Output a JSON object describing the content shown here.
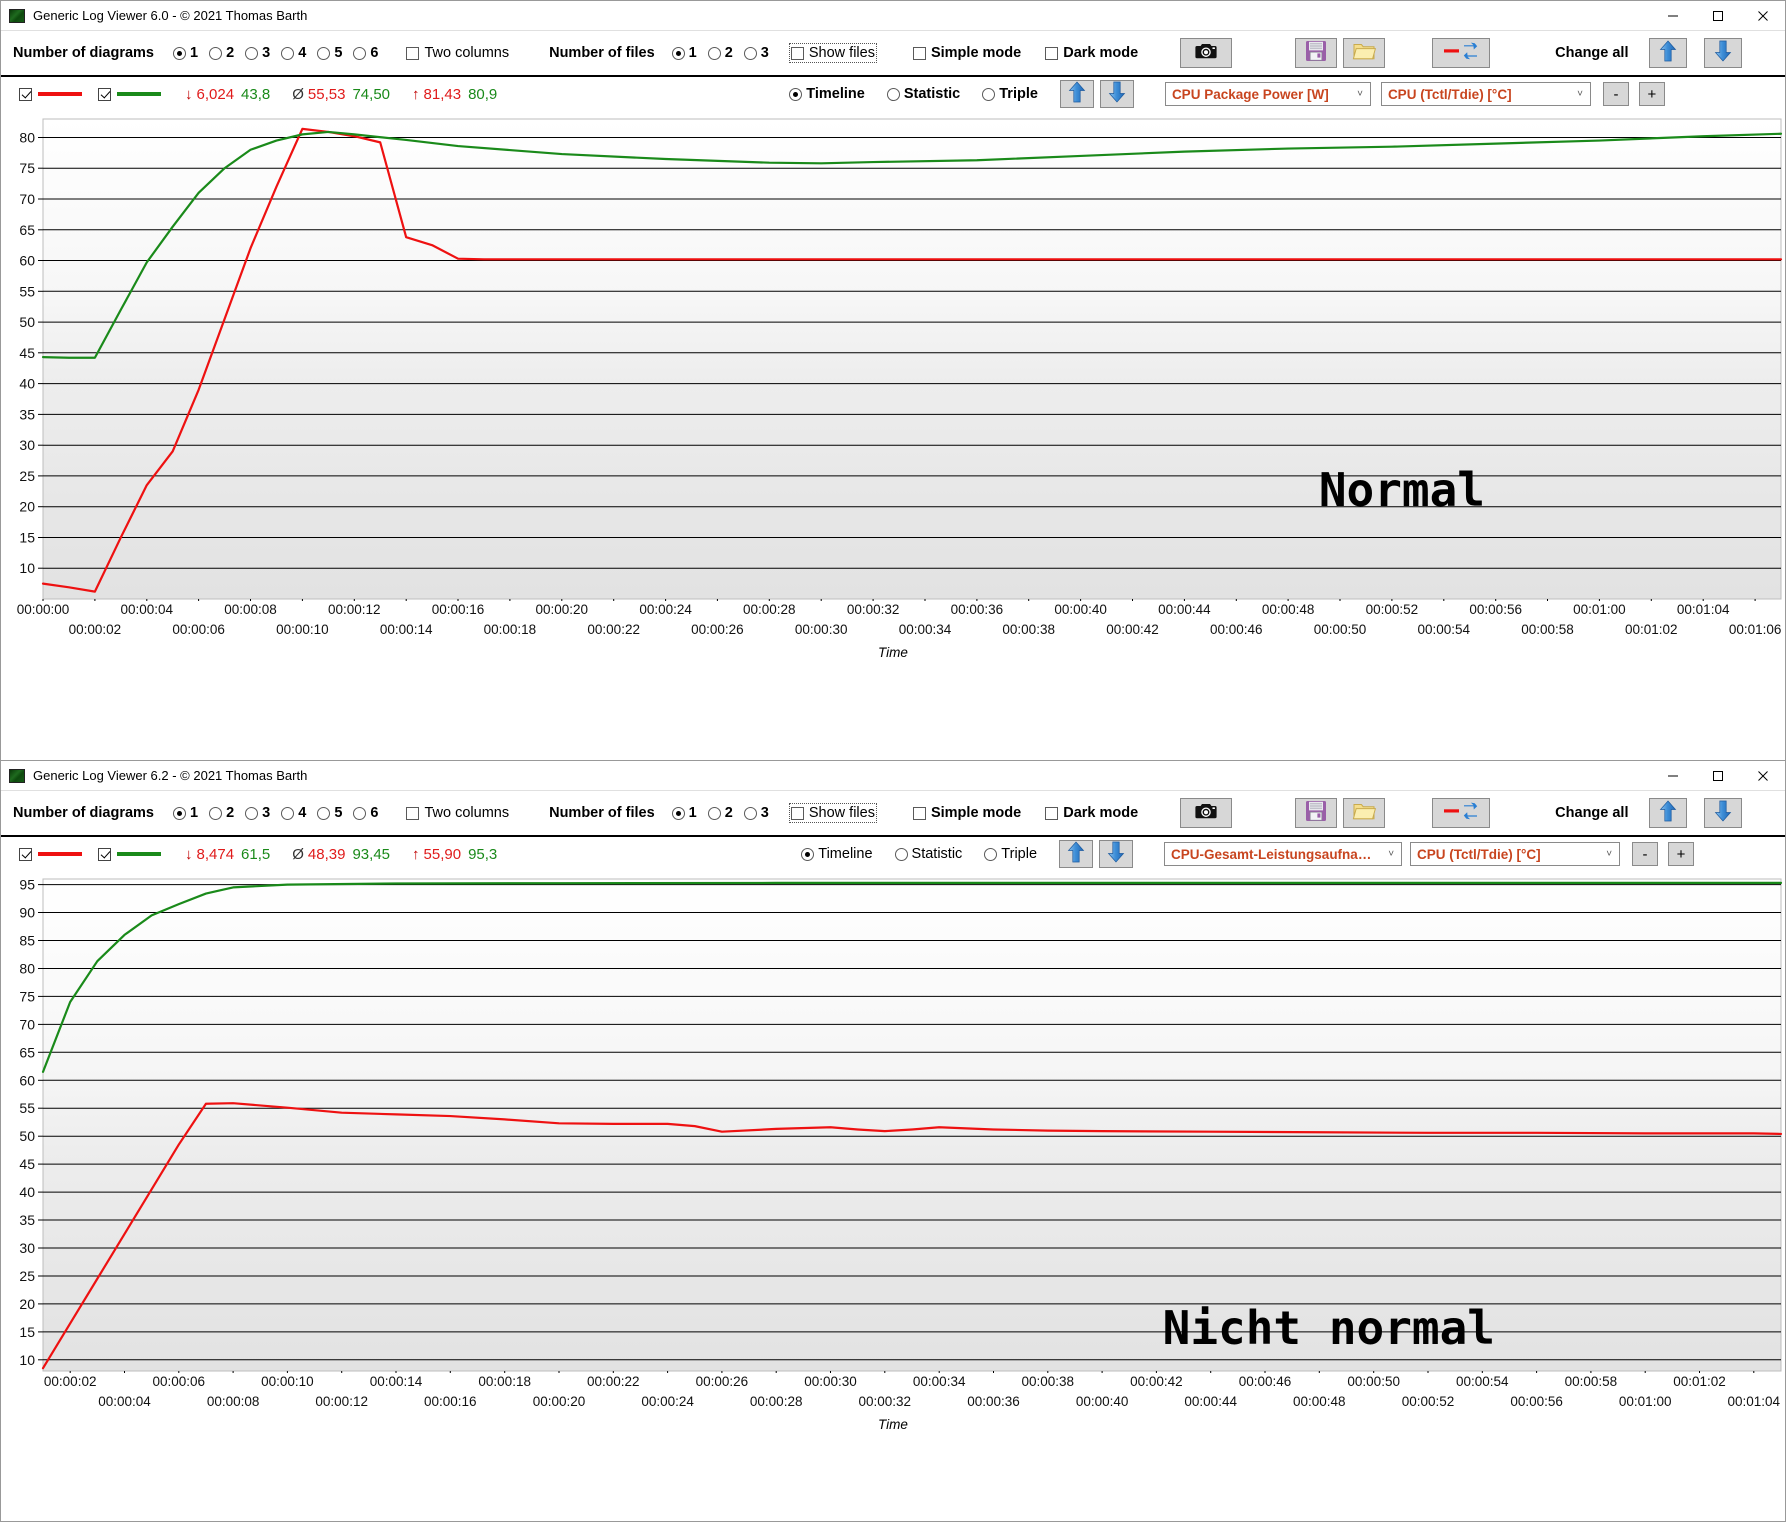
{
  "windows": [
    {
      "title": "Generic Log Viewer 6.0 - © 2021 Thomas Barth",
      "window_buttons": {
        "minimize": "minimize-icon",
        "maximize": "maximize-icon",
        "close": "close-icon"
      },
      "toolbar": {
        "diagrams_label": "Number of diagrams",
        "diagram_options": [
          "1",
          "2",
          "3",
          "4",
          "5",
          "6"
        ],
        "diagram_selected": "1",
        "two_columns_label": "Two columns",
        "two_columns_checked": false,
        "files_label": "Number of files",
        "file_options": [
          "1",
          "2",
          "3"
        ],
        "file_selected": "1",
        "show_files_label": "Show files",
        "show_files_checked": false,
        "simple_mode_label": "Simple mode",
        "simple_mode_checked": false,
        "dark_mode_label": "Dark mode",
        "dark_mode_checked": false,
        "screenshot_icon": "camera-icon",
        "save_icon": "floppy-disk-icon",
        "open_icon": "folder-icon",
        "reload_icon": "refresh-icon",
        "change_all_label": "Change all",
        "change_all_up_icon": "arrow-up-icon",
        "change_all_down_icon": "arrow-down-icon"
      },
      "chartbar": {
        "series1_checked": true,
        "series2_checked": true,
        "series1_color": "#ee1111",
        "series2_color": "#1a8a1a",
        "min_symbol": "↓",
        "min_red": "6,024",
        "min_green": "43,8",
        "avg_symbol": "Ø",
        "avg_red": "55,53",
        "avg_green": "74,50",
        "max_symbol": "↑",
        "max_red": "81,43",
        "max_green": "80,9",
        "view_modes": [
          "Timeline",
          "Statistic",
          "Triple"
        ],
        "view_mode_selected": "Timeline",
        "up_icon": "arrow-up-icon",
        "down_icon": "arrow-down-icon",
        "left_series_select": "CPU Package Power [W]",
        "right_series_select": "CPU (Tctl/Tdie) [°C]",
        "minus_label": "-",
        "plus_label": "+"
      },
      "annotation": "Normal",
      "xaxis_title": "Time",
      "chart_data": {
        "type": "line",
        "title": "",
        "xlabel": "Time",
        "ylabel": "",
        "ylim": [
          5,
          83
        ],
        "yticks": [
          10,
          15,
          20,
          25,
          30,
          35,
          40,
          45,
          50,
          55,
          60,
          65,
          70,
          75,
          80
        ],
        "xlim": [
          0,
          67
        ],
        "xticks_seconds": [
          0,
          2,
          4,
          6,
          8,
          10,
          12,
          14,
          16,
          18,
          20,
          22,
          24,
          26,
          28,
          30,
          32,
          34,
          36,
          38,
          40,
          42,
          44,
          46,
          48,
          50,
          52,
          54,
          56,
          58,
          60,
          62,
          64,
          66
        ],
        "xticklabels": [
          "00:00:00",
          "00:00:02",
          "00:00:04",
          "00:00:06",
          "00:00:08",
          "00:00:10",
          "00:00:12",
          "00:00:14",
          "00:00:16",
          "00:00:18",
          "00:00:20",
          "00:00:22",
          "00:00:24",
          "00:00:26",
          "00:00:28",
          "00:00:30",
          "00:00:32",
          "00:00:34",
          "00:00:36",
          "00:00:38",
          "00:00:40",
          "00:00:42",
          "00:00:44",
          "00:00:46",
          "00:00:48",
          "00:00:50",
          "00:00:52",
          "00:00:54",
          "00:00:56",
          "00:00:58",
          "00:01:00",
          "00:01:02",
          "00:01:04",
          "00:01:06"
        ],
        "grid": true,
        "legend_position": "top-left",
        "series": [
          {
            "name": "CPU Package Power [W]",
            "color": "#ee1111",
            "unit": "W",
            "x": [
              0,
              1,
              2,
              3,
              4,
              5,
              6,
              7,
              8,
              9,
              10,
              11,
              12,
              13,
              14,
              15,
              16,
              17,
              20,
              24,
              28,
              32,
              36,
              40,
              44,
              48,
              52,
              56,
              60,
              64,
              67
            ],
            "values": [
              7.5,
              6.9,
              6.2,
              15.0,
              23.5,
              29.0,
              39.0,
              50.5,
              62.0,
              72.0,
              81.4,
              80.9,
              80.2,
              79.2,
              63.8,
              62.5,
              60.3,
              60.2,
              60.2,
              60.2,
              60.2,
              60.2,
              60.2,
              60.2,
              60.2,
              60.2,
              60.2,
              60.2,
              60.2,
              60.2,
              60.2
            ]
          },
          {
            "name": "CPU (Tctl/Tdie) [°C]",
            "color": "#1a8a1a",
            "unit": "°C",
            "x": [
              0,
              1,
              2,
              3,
              4,
              5,
              6,
              7,
              8,
              9,
              10,
              11,
              12,
              14,
              16,
              20,
              24,
              28,
              30,
              32,
              36,
              40,
              44,
              48,
              52,
              56,
              60,
              64,
              67
            ],
            "values": [
              44.3,
              44.2,
              44.2,
              52.0,
              59.7,
              65.5,
              71.0,
              75.0,
              78.0,
              79.5,
              80.5,
              80.9,
              80.5,
              79.6,
              78.6,
              77.3,
              76.5,
              75.9,
              75.8,
              76.0,
              76.3,
              77.0,
              77.7,
              78.2,
              78.5,
              79.0,
              79.5,
              80.2,
              80.6
            ]
          }
        ]
      }
    },
    {
      "title": "Generic Log Viewer 6.2 - © 2021 Thomas Barth",
      "window_buttons": {
        "minimize": "minimize-icon",
        "maximize": "maximize-icon",
        "close": "close-icon"
      },
      "toolbar": {
        "diagrams_label": "Number of diagrams",
        "diagram_options": [
          "1",
          "2",
          "3",
          "4",
          "5",
          "6"
        ],
        "diagram_selected": "1",
        "two_columns_label": "Two columns",
        "two_columns_checked": false,
        "files_label": "Number of files",
        "file_options": [
          "1",
          "2",
          "3"
        ],
        "file_selected": "1",
        "show_files_label": "Show files",
        "show_files_checked": false,
        "simple_mode_label": "Simple mode",
        "simple_mode_checked": false,
        "dark_mode_label": "Dark mode",
        "dark_mode_checked": false,
        "screenshot_icon": "camera-icon",
        "save_icon": "floppy-disk-icon",
        "open_icon": "folder-icon",
        "reload_icon": "refresh-icon",
        "change_all_label": "Change all",
        "change_all_up_icon": "arrow-up-icon",
        "change_all_down_icon": "arrow-down-icon"
      },
      "chartbar": {
        "series1_checked": true,
        "series2_checked": true,
        "series1_color": "#ee1111",
        "series2_color": "#1a8a1a",
        "min_symbol": "↓",
        "min_red": "8,474",
        "min_green": "61,5",
        "avg_symbol": "Ø",
        "avg_red": "48,39",
        "avg_green": "93,45",
        "max_symbol": "↑",
        "max_red": "55,90",
        "max_green": "95,3",
        "view_modes": [
          "Timeline",
          "Statistic",
          "Triple"
        ],
        "view_mode_selected": "Timeline",
        "up_icon": "arrow-up-icon",
        "down_icon": "arrow-down-icon",
        "left_series_select": "CPU-Gesamt-Leistungsaufnahme [W]",
        "right_series_select": "CPU (Tctl/Tdie) [°C]",
        "minus_label": "-",
        "plus_label": "+"
      },
      "annotation": "Nicht normal",
      "xaxis_title": "Time",
      "chart_data": {
        "type": "line",
        "title": "",
        "xlabel": "Time",
        "ylabel": "",
        "ylim": [
          8,
          96
        ],
        "yticks": [
          10,
          15,
          20,
          25,
          30,
          35,
          40,
          45,
          50,
          55,
          60,
          65,
          70,
          75,
          80,
          85,
          90,
          95
        ],
        "xlim": [
          1,
          65
        ],
        "xticks_seconds": [
          2,
          4,
          6,
          8,
          10,
          12,
          14,
          16,
          18,
          20,
          22,
          24,
          26,
          28,
          30,
          32,
          34,
          36,
          38,
          40,
          42,
          44,
          46,
          48,
          50,
          52,
          54,
          56,
          58,
          60,
          62,
          64
        ],
        "xticklabels": [
          "00:00:02",
          "00:00:04",
          "00:00:06",
          "00:00:08",
          "00:00:10",
          "00:00:12",
          "00:00:14",
          "00:00:16",
          "00:00:18",
          "00:00:20",
          "00:00:22",
          "00:00:24",
          "00:00:26",
          "00:00:28",
          "00:00:30",
          "00:00:32",
          "00:00:34",
          "00:00:36",
          "00:00:38",
          "00:00:40",
          "00:00:42",
          "00:00:44",
          "00:00:46",
          "00:00:48",
          "00:00:50",
          "00:00:52",
          "00:00:54",
          "00:00:56",
          "00:00:58",
          "00:01:00",
          "00:01:02",
          "00:01:04"
        ],
        "grid": true,
        "legend_position": "top-left",
        "series": [
          {
            "name": "CPU-Gesamt-Leistungsaufnahme [W]",
            "color": "#ee1111",
            "unit": "W",
            "x": [
              1,
              2,
              3,
              4,
              5,
              6,
              7,
              8,
              10,
              12,
              14,
              16,
              18,
              20,
              22,
              24,
              25,
              26,
              28,
              30,
              31,
              32,
              33,
              34,
              35,
              36,
              38,
              40,
              44,
              48,
              52,
              56,
              60,
              64,
              65
            ],
            "values": [
              8.5,
              16.5,
              24.5,
              32.5,
              40.5,
              48.5,
              55.8,
              55.9,
              55.1,
              54.2,
              53.9,
              53.6,
              53.0,
              52.3,
              52.2,
              52.2,
              51.8,
              50.8,
              51.3,
              51.6,
              51.2,
              50.9,
              51.2,
              51.6,
              51.4,
              51.2,
              51.0,
              50.9,
              50.8,
              50.7,
              50.6,
              50.6,
              50.5,
              50.5,
              50.4
            ]
          },
          {
            "name": "CPU (Tctl/Tdie) [°C]",
            "color": "#1a8a1a",
            "unit": "°C",
            "x": [
              1,
              2,
              3,
              4,
              5,
              6,
              7,
              8,
              10,
              14,
              20,
              28,
              36,
              44,
              52,
              60,
              65
            ],
            "values": [
              61.5,
              74.0,
              81.3,
              86.0,
              89.5,
              91.5,
              93.4,
              94.5,
              95.0,
              95.2,
              95.25,
              95.3,
              95.3,
              95.3,
              95.3,
              95.3,
              95.3
            ]
          }
        ]
      }
    }
  ]
}
